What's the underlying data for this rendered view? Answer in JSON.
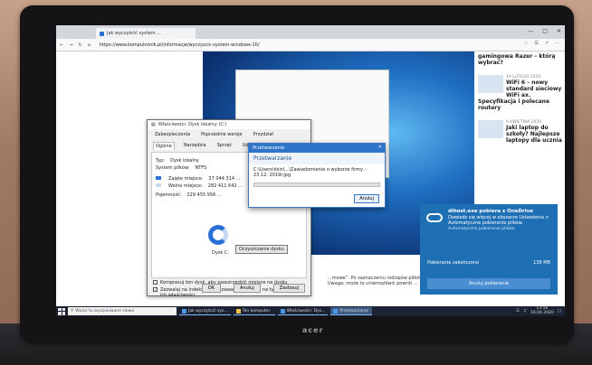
{
  "browser": {
    "tab_title": "Jak wyczyścić system ...",
    "url": "https://www.komputronik.pl/informacje/wyczyscic-system-windows-10/"
  },
  "sidebar": {
    "articles": [
      {
        "date": "",
        "title": "gamingowa Razer – którą wybrać?"
      },
      {
        "date": "19 LUTEGO 2020",
        "title": "WiFi 6 – nowy standard sieciowy WiFi ax. Specyfikacja i polecane routery"
      },
      {
        "date": "9 KWIETNIA 2020",
        "title": "Jaki laptop do szkoły? Najlepsze laptopy dla ucznia"
      }
    ]
  },
  "page_text": "...mowe”. Po zaznaczeniu rodzajów plików ... pozostałe. Uwaga: może to uniemożliwić powrót ...",
  "properties_dialog": {
    "title": "Właściwości: Dysk lokalny (C:)",
    "tabs_top": [
      "Zabezpieczenia",
      "Poprzednie wersje",
      "Przydział"
    ],
    "tabs_bottom": [
      "Ogólne",
      "Narzędzia",
      "Sprzęt",
      "Udostępnianie"
    ],
    "type_label": "Typ:",
    "type_value": "Dysk lokalny",
    "fs_label": "System plików:",
    "fs_value": "NTFS",
    "used_label": "Zajęte miejsce:",
    "used_value": "37 044 314 ...",
    "free_label": "Wolne miejsce:",
    "free_value": "282 411 642 ...",
    "capacity_label": "Pojemność:",
    "capacity_value": "229 455 956 ...",
    "drive_label": "Dysk C:",
    "cleanup_button": "Oczyszczanie dysku",
    "check1": "Kompresuj ten dysk, aby zaoszczędzić miejsce na dysku",
    "check2": "Zezwalaj na indeksowanie zawartości plików na tym dysku oraz ich właściwości",
    "ok": "OK",
    "cancel": "Anuluj",
    "apply": "Zastosuj"
  },
  "processing_dialog": {
    "title": "Przetwarzanie",
    "heading": "Przetwarzanie",
    "file_path": "C:\\Users\\dsin\\...\\Zawiadomienie o wyborze firmy - 23.12. 2019r.jpg",
    "cancel_button": "Anuluj",
    "progress": 0
  },
  "notification": {
    "title": "dlhost.exe pobiera z OneDrive",
    "message": "Dowiedz się więcej w obszarze Ustawienia > Automatyczne pobieranie plików.",
    "subtext": "Automatyczne pobieranie plików",
    "status": "Pobieranie zakończono",
    "size": "138 MB",
    "button": "Anuluj pobieranie"
  },
  "taskbar": {
    "search_placeholder": "Wpisz tu wyszukiwane słowa",
    "tasks": [
      "Jak wyczyścić sys...",
      "Ten komputer",
      "Właściwości: Dys...",
      "Przetwarzanie"
    ],
    "time": "13:56",
    "date": "16.04.2020"
  },
  "brand": "acer"
}
